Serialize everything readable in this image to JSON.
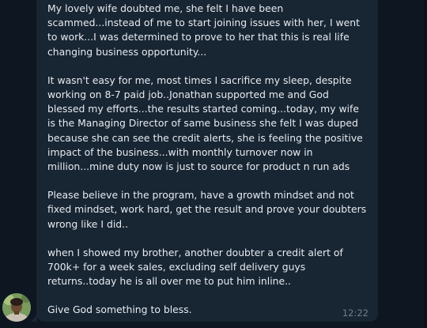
{
  "message": {
    "paragraphs": [
      "My lovely wife doubted me, she felt I have been scammed...instead of me to start joining issues with her, I went to work...I was determined to prove to her that this is real life changing business opportunity...",
      "It wasn't easy for me, most times I sacrifice my sleep, despite working on 8-7 paid job..Jonathan supported me and God blessed my efforts...the results started coming...today, my wife is the Managing Director of same business she felt I was duped because she can see the credit alerts, she is feeling the positive impact of the business...with monthly turnover now in million...mine duty now is just to source for product n run ads",
      "Please believe in the program, have a growth mindset and not fixed mindset, work hard, get the result and prove your doubters wrong like I did..",
      "when I showed my brother, another doubter a credit alert of 700k+ for a week sales, excluding self delivery guys returns..today he is all over me to put him inline..",
      "Give God something to bless."
    ],
    "time": "12:22"
  },
  "colors": {
    "background": "#0e1621",
    "bubble": "#182533",
    "text": "#e6ebf0",
    "time": "#6d7f8f"
  },
  "icons": {
    "avatar": "sender-avatar"
  }
}
